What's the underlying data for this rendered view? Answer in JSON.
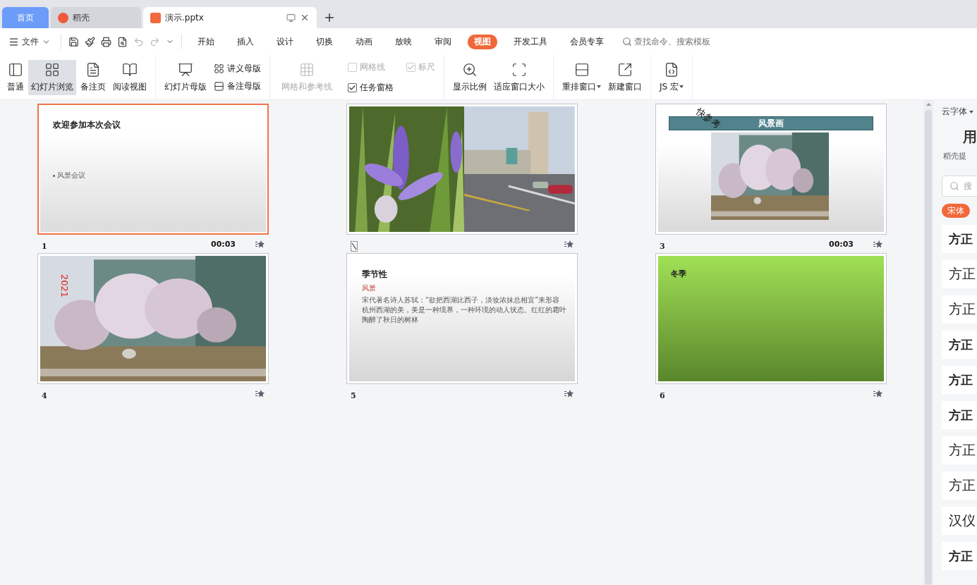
{
  "tabs": [
    {
      "label": "首页",
      "kind": "home",
      "selected": false
    },
    {
      "label": "稻壳",
      "kind": "docer",
      "selected": false
    },
    {
      "label": "演示.pptx",
      "kind": "file",
      "selected": true
    }
  ],
  "menu": {
    "file": "文件",
    "quick_access": [
      {
        "disabled": false
      },
      {
        "disabled": false
      },
      {
        "disabled": false
      },
      {
        "disabled": false
      },
      {
        "disabled": true
      },
      {
        "disabled": true
      },
      {
        "disabled": false
      }
    ],
    "tabs": [
      {
        "label": "开始",
        "selected": false
      },
      {
        "label": "插入",
        "selected": false
      },
      {
        "label": "设计",
        "selected": false
      },
      {
        "label": "切换",
        "selected": false
      },
      {
        "label": "动画",
        "selected": false
      },
      {
        "label": "放映",
        "selected": false
      },
      {
        "label": "审阅",
        "selected": false
      },
      {
        "label": "视图",
        "selected": true
      },
      {
        "label": "开发工具",
        "selected": false
      },
      {
        "label": "会员专享",
        "selected": false
      }
    ],
    "search": {
      "placeholder": "查找命令、搜索模板"
    }
  },
  "ribbon": {
    "groups": [
      {
        "items": [
          {
            "kind": "large",
            "label": "普通",
            "selected": false,
            "disabled": false
          },
          {
            "kind": "large",
            "label": "幻灯片浏览",
            "selected": true,
            "disabled": false
          },
          {
            "kind": "large",
            "label": "备注页",
            "selected": false,
            "disabled": false
          },
          {
            "kind": "large",
            "label": "阅读视图",
            "selected": false,
            "disabled": false
          }
        ]
      },
      {
        "items": [
          {
            "kind": "large",
            "label": "幻灯片母版",
            "selected": false,
            "disabled": false
          },
          {
            "kind": "small",
            "label": "讲义母版"
          },
          {
            "kind": "small",
            "label": "备注母版"
          }
        ]
      },
      {
        "items": [
          {
            "kind": "check",
            "label": "网格线",
            "checked": false,
            "disabled": true
          },
          {
            "kind": "check",
            "label": "标尺",
            "checked": true,
            "disabled": true
          },
          {
            "kind": "large",
            "label": "网格和参考线",
            "selected": false,
            "disabled": true
          },
          {
            "kind": "check",
            "label": "任务窗格",
            "checked": true,
            "disabled": false
          }
        ]
      },
      {
        "items": [
          {
            "kind": "large",
            "label": "显示比例",
            "selected": false,
            "disabled": false
          },
          {
            "kind": "large",
            "label": "适应窗口大小",
            "selected": false,
            "disabled": false
          }
        ]
      },
      {
        "items": [
          {
            "kind": "large",
            "label": "重排窗口",
            "selected": false,
            "disabled": false,
            "dropdown": true
          },
          {
            "kind": "large",
            "label": "新建窗口",
            "selected": false,
            "disabled": false
          }
        ]
      },
      {
        "items": [
          {
            "kind": "large",
            "label": "JS 宏",
            "selected": false,
            "disabled": false,
            "dropdown": true
          }
        ]
      }
    ]
  },
  "slides": [
    {
      "kind": "title",
      "number": "1",
      "selected": true,
      "hidden": false,
      "timing": "00:03",
      "title": "欢迎参加本次会议",
      "bullet": "风景会议"
    },
    {
      "kind": "photos",
      "selected": false,
      "hidden": true
    },
    {
      "kind": "banner",
      "number": "3",
      "selected": false,
      "hidden": false,
      "timing": "00:03",
      "title": "风景画",
      "overlay": "快参考"
    },
    {
      "number": "4",
      "selected": false,
      "hidden": false,
      "overlay": "2021"
    },
    {
      "kind": "text",
      "number": "5",
      "selected": false,
      "hidden": false,
      "title": "季节性",
      "subtitle": "风景",
      "body": "宋代著名诗人苏轼：“欲把西湖比西子，淡妆浓抹总相宜”来形容杭州西湖的美，美是一种境界，一种环境的动人状态。红红的霜叶陶醉了秋日的树林"
    },
    {
      "kind": "green",
      "number": "6",
      "selected": false,
      "hidden": false,
      "title": "冬季"
    }
  ],
  "font_panel": {
    "source": "云字体",
    "heading": "用",
    "subtitle": "稻壳提",
    "search": {
      "placeholder": "搜"
    },
    "tags": [
      {
        "label": "宋体",
        "selected": true
      }
    ],
    "fonts": [
      {
        "label": "方正",
        "bold": true
      },
      {
        "label": "方正",
        "bold": false
      },
      {
        "label": "方正",
        "bold": false
      },
      {
        "label": "方正",
        "bold": true
      },
      {
        "label": "方正",
        "bold": true
      },
      {
        "label": "方正",
        "bold": true
      },
      {
        "label": "方正",
        "bold": false
      },
      {
        "label": "方正",
        "bold": false
      },
      {
        "label": "汉仪",
        "bold": false
      },
      {
        "label": "方正",
        "bold": true
      }
    ]
  }
}
